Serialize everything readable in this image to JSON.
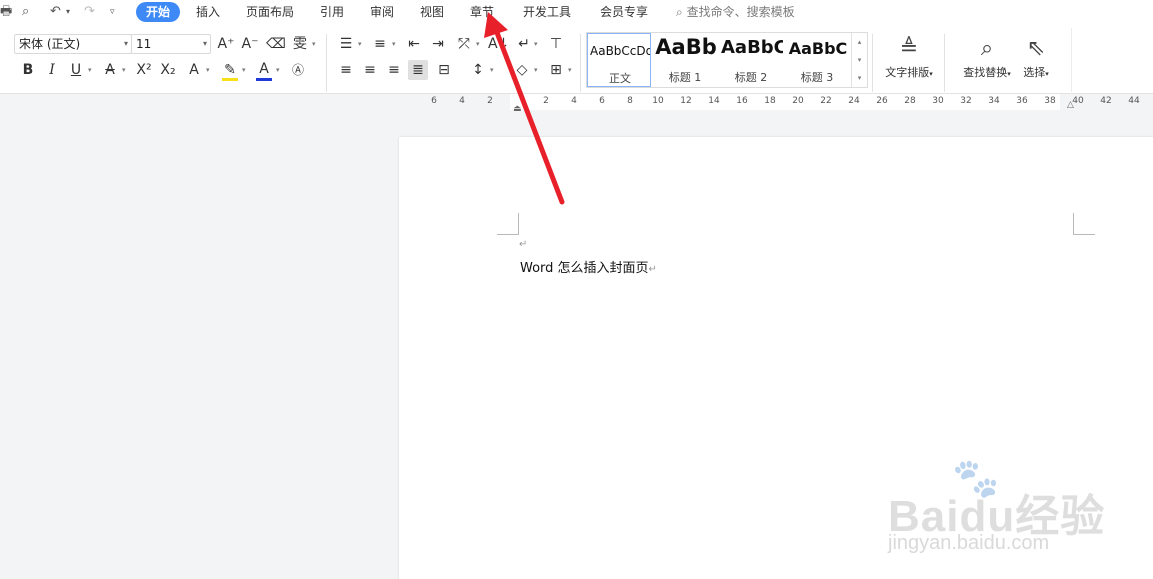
{
  "menubar": {
    "tabs": [
      "开始",
      "插入",
      "页面布局",
      "引用",
      "审阅",
      "视图",
      "章节",
      "开发工具",
      "会员专享"
    ],
    "active_tab": "开始",
    "search_placeholder": "查找命令、搜索模板"
  },
  "ribbon": {
    "font_name": "宋体 (正文)",
    "font_size": "11",
    "styles": [
      {
        "preview": "AaBbCcDd",
        "label": "正文"
      },
      {
        "preview": "AaBb",
        "label": "标题 1"
      },
      {
        "preview": "AaBbC",
        "label": "标题 2"
      },
      {
        "preview": "AaBbC",
        "label": "标题 3"
      }
    ],
    "text_layout_label": "文字排版",
    "find_replace_label": "查找替换",
    "select_label": "选择",
    "colors": {
      "accent": "#3d8af7",
      "highlight": "#f7e017",
      "font_color": "#1f39d9",
      "arrow": "#e8202a"
    }
  },
  "ruler": {
    "ticks": [
      "6",
      "4",
      "2",
      "",
      "2",
      "4",
      "6",
      "8",
      "10",
      "12",
      "14",
      "16",
      "18",
      "20",
      "22",
      "24",
      "26",
      "28",
      "30",
      "32",
      "34",
      "36",
      "38",
      "40",
      "42",
      "44"
    ]
  },
  "document": {
    "line1": "Word 怎么插入封面页"
  },
  "watermark": {
    "logo": "Baidu经验",
    "url": "jingyan.baidu.com"
  }
}
